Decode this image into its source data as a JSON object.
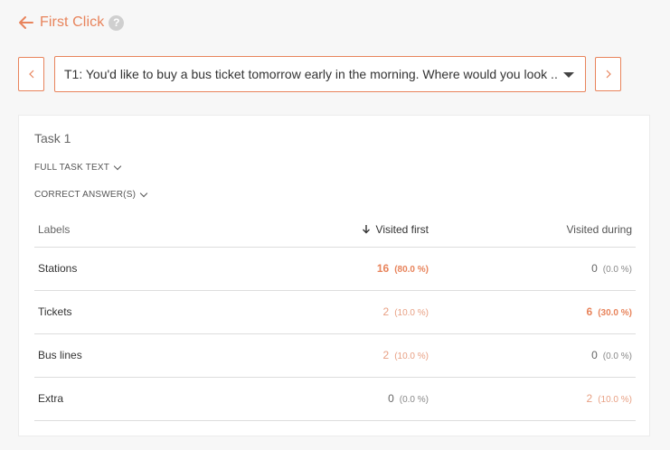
{
  "header": {
    "title": "First Click",
    "help": "?"
  },
  "task_selector": {
    "value": "T1: You'd like to buy a bus ticket tomorrow early in the morning. Where would you look ..."
  },
  "card": {
    "task_label": "Task 1",
    "full_task_text_label": "FULL TASK TEXT",
    "correct_answers_label": "CORRECT ANSWER(S)",
    "columns": {
      "labels": "Labels",
      "visited_first": "Visited first",
      "visited_during": "Visited during"
    },
    "rows": [
      {
        "label": "Stations",
        "first_value": "16",
        "first_pct": "(80.0 %)",
        "during_value": "0",
        "during_pct": "(0.0 %)"
      },
      {
        "label": "Tickets",
        "first_value": "2",
        "first_pct": "(10.0 %)",
        "during_value": "6",
        "during_pct": "(30.0 %)"
      },
      {
        "label": "Bus lines",
        "first_value": "2",
        "first_pct": "(10.0 %)",
        "during_value": "0",
        "during_pct": "(0.0 %)"
      },
      {
        "label": "Extra",
        "first_value": "0",
        "first_pct": "(0.0 %)",
        "during_value": "2",
        "during_pct": "(10.0 %)"
      }
    ]
  },
  "colors": {
    "accent": "#e8845c",
    "accent_light": "#e8a084",
    "background": "#f7f7f7"
  }
}
